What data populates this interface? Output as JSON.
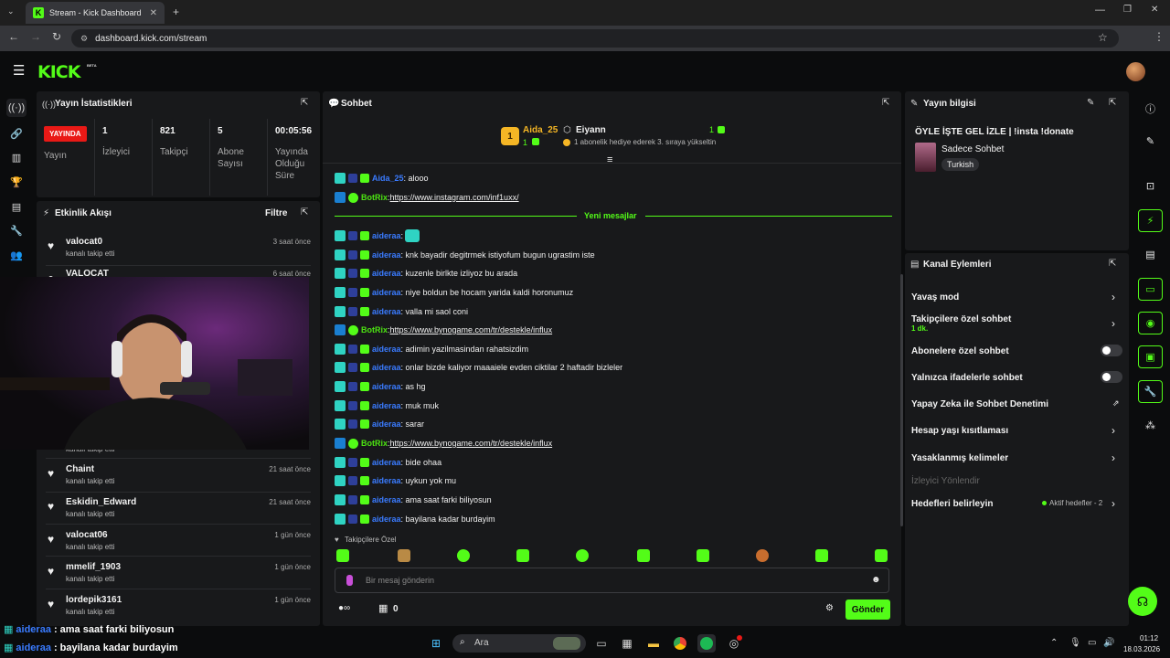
{
  "browser": {
    "tab_title": "Stream - Kick Dashboard",
    "url": "dashboard.kick.com/stream"
  },
  "header": {
    "logo": "KICK",
    "badge": "BETA"
  },
  "stats": {
    "title": "Yayın İstatistikleri",
    "live_badge": "YAYINDA",
    "status_label": "Yayın",
    "cols": [
      {
        "value": "1",
        "label": "İzleyici"
      },
      {
        "value": "821",
        "label": "Takipçi"
      },
      {
        "value": "5",
        "label": "Abone Sayısı"
      },
      {
        "value": "00:05:56",
        "label": "Yayında Olduğu Süre"
      }
    ]
  },
  "activity": {
    "title": "Etkinlik Akışı",
    "filter": "Filtre",
    "items": [
      {
        "name": "valocat0",
        "sub": "kanalı takip etti",
        "time": "3 saat önce"
      },
      {
        "name": "VALOCAT",
        "sub": "",
        "time": "6 saat önce"
      },
      {
        "name": "Chaint",
        "sub": "kanalı takip etti",
        "time": "21 saat önce"
      },
      {
        "name": "Eskidin_Edward",
        "sub": "kanalı takip etti",
        "time": "21 saat önce"
      },
      {
        "name": "valocat06",
        "sub": "kanalı takip etti",
        "time": "1 gün önce"
      },
      {
        "name": "mmelif_1903",
        "sub": "kanalı takip etti",
        "time": "1 gün önce"
      },
      {
        "name": "lordepik3161",
        "sub": "kanalı takip etti",
        "time": "1 gün önce"
      }
    ],
    "partial_sub": "kanalı takip etti"
  },
  "chat": {
    "title": "Sohbet",
    "leader": {
      "rank": "1",
      "name": "Aida_25",
      "count": "1"
    },
    "gift": {
      "name": "Eiyann",
      "count": "1",
      "text": "1 abonelik hediye ederek 3. sıraya yükseltin"
    },
    "new_messages_label": "Yeni mesajlar",
    "messages": [
      {
        "user": "Aida_25",
        "kind": "user",
        "text": ": alooo"
      },
      {
        "user": "BotRix",
        "kind": "bot",
        "text": ": ",
        "link": "https://www.instagram.com/inf1uxx/"
      },
      {
        "user": "aideraa",
        "kind": "user",
        "text": ": "
      },
      {
        "user": "aideraa",
        "kind": "user",
        "text": ": knk bayadir degitrmek istiyofum bugun ugrastim iste"
      },
      {
        "user": "aideraa",
        "kind": "user",
        "text": ": kuzenle birlkte izliyoz bu arada"
      },
      {
        "user": "aideraa",
        "kind": "user",
        "text": ": niye boldun be hocam yarida kaldi horonumuz"
      },
      {
        "user": "aideraa",
        "kind": "user",
        "text": ": valla mi saol coni"
      },
      {
        "user": "BotRix",
        "kind": "bot",
        "text": ": ",
        "link": "https://www.bynogame.com/tr/destekle/influx"
      },
      {
        "user": "aideraa",
        "kind": "user",
        "text": ": adimin yazilmasindan rahatsizdim"
      },
      {
        "user": "aideraa",
        "kind": "user",
        "text": ": onlar bizde kaliyor maaaiele evden ciktilar 2 haftadir bizleler"
      },
      {
        "user": "aideraa",
        "kind": "user",
        "text": ": as hg"
      },
      {
        "user": "aideraa",
        "kind": "user",
        "text": ": muk muk"
      },
      {
        "user": "aideraa",
        "kind": "user",
        "text": ": sarar"
      },
      {
        "user": "BotRix",
        "kind": "bot",
        "text": ": ",
        "link": "https://www.bynogame.com/tr/destekle/influx"
      },
      {
        "user": "aideraa",
        "kind": "user",
        "text": ": bide ohaa"
      },
      {
        "user": "aideraa",
        "kind": "user",
        "text": ": uykun yok mu"
      },
      {
        "user": "aideraa",
        "kind": "user",
        "text": ": ama saat farki biliyosun"
      },
      {
        "user": "aideraa",
        "kind": "user",
        "text": ": bayilana kadar burdayim"
      }
    ],
    "followers_only": "Takipçilere Özel",
    "input_placeholder": "Bir mesaj gönderin",
    "points": "0",
    "send": "Gönder"
  },
  "stream_info": {
    "title": "Yayın bilgisi",
    "stream_title": "ÖYLE İŞTE GEL İZLE | !insta !donate",
    "category": "Sadece Sohbet",
    "tag": "Turkish"
  },
  "channel_actions": {
    "title": "Kanal Eylemleri",
    "slow_mode": "Yavaş mod",
    "followers_chat": "Takipçilere özel sohbet",
    "followers_chat_sub": "1 dk.",
    "subs_chat": "Abonelere özel sohbet",
    "emote_chat": "Yalnızca ifadelerle sohbet",
    "ai_moderation": "Yapay Zeka ile Sohbet Denetimi",
    "account_age": "Hesap yaşı kısıtlaması",
    "banned_words": "Yasaklanmış kelimeler",
    "viewer_redirect": "İzleyici Yönlendir",
    "goals": "Hedefleri belirleyin",
    "goals_status": "Aktif hedefler - 2"
  },
  "overlay": [
    {
      "user": "aideraa",
      "text": ": ama saat farki biliyosun"
    },
    {
      "user": "aideraa",
      "text": ": bayilana kadar burdayim"
    }
  ],
  "taskbar": {
    "search": "Ara",
    "time": "01:12",
    "date": "18.03.2026"
  },
  "colors": {
    "accent": "#53fc18",
    "live": "#e91916",
    "panel": "#18191b",
    "bg": "#0b0c0d",
    "username": "#3a7bff"
  }
}
